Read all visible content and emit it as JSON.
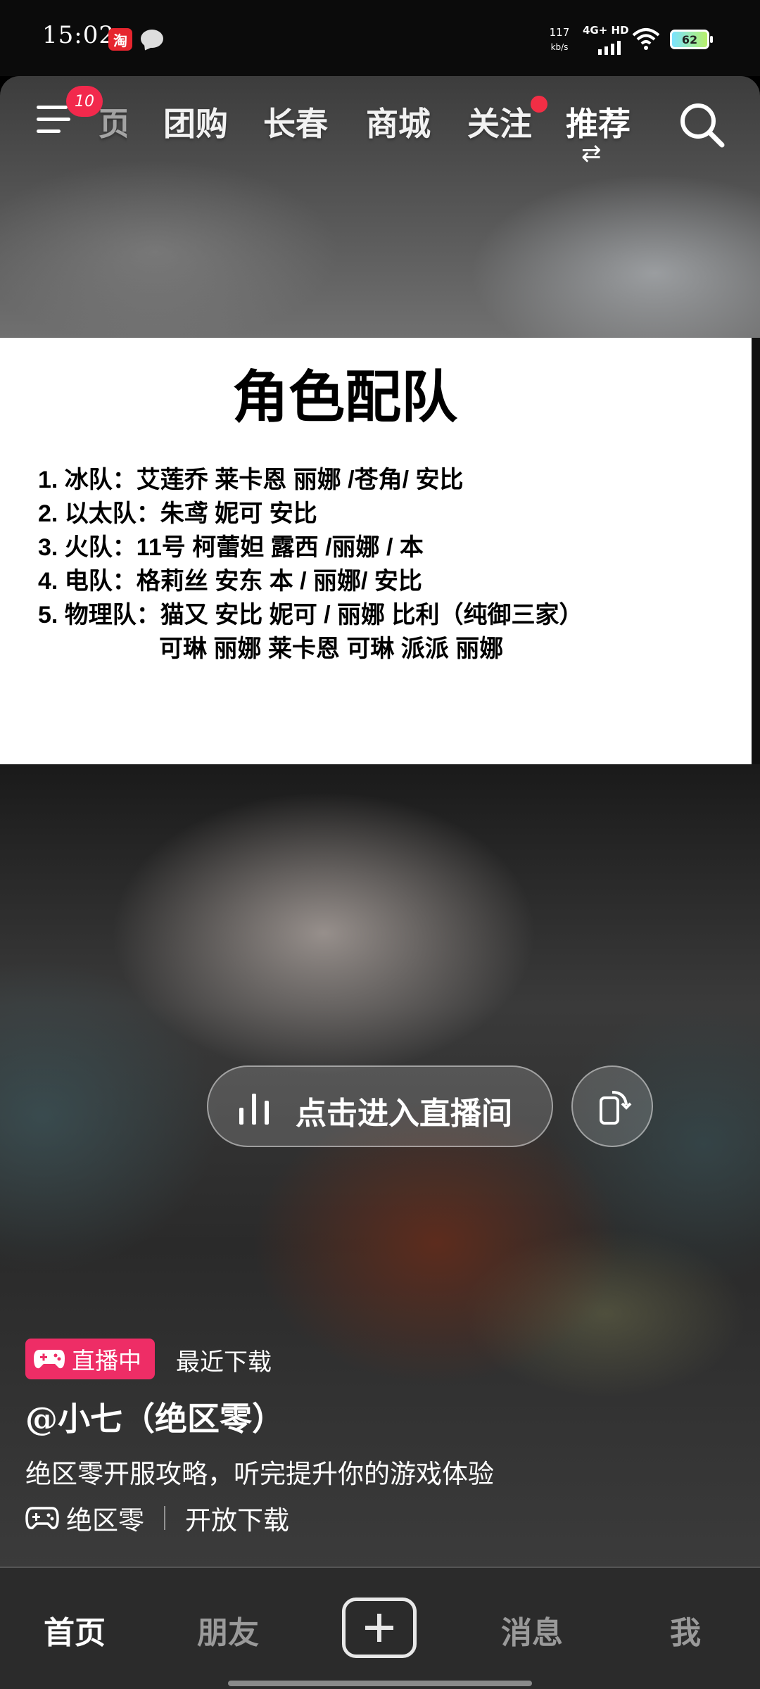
{
  "status_bar": {
    "time": "15:02",
    "app_icon_text": "淘",
    "speed_value": "117",
    "speed_unit": "kb/s",
    "network": "4G+ HD",
    "battery": "62"
  },
  "top_nav": {
    "menu_badge": "10",
    "partial_tab": "页",
    "tabs": [
      "团购",
      "长春",
      "商城",
      "关注",
      "推荐"
    ]
  },
  "document": {
    "title": "角色配队",
    "lines": [
      "1. 冰队：艾莲乔  莱卡恩  丽娜   /苍角/ 安比",
      "2. 以太队：朱鸢 妮可 安比",
      "3. 火队：11号 柯蕾妲 露西 /丽娜 / 本",
      "4. 电队：格莉丝 安东  本  / 丽娜/  安比",
      "5. 物理队：猫又 安比 妮可 / 丽娜    比利（纯御三家）"
    ],
    "line6": "可琳  丽娜  莱卡恩       可琳 派派 丽娜"
  },
  "live": {
    "enter_label": "点击进入直播间",
    "badge": "直播中",
    "recent_download": "最近下载",
    "author": "@小七（绝区零）",
    "description": "绝区零开服攻略，听完提升你的游戏体验",
    "game_name": "绝区零",
    "game_status": "开放下载"
  },
  "bottom_nav": {
    "home": "首页",
    "friends": "朋友",
    "messages": "消息",
    "me": "我"
  }
}
